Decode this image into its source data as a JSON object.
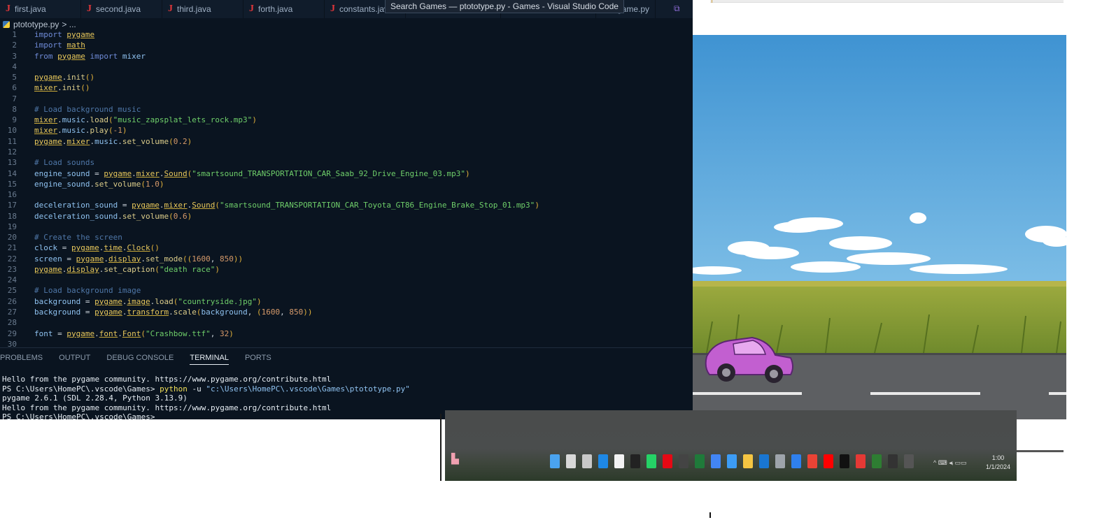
{
  "vscode": {
    "tabs": [
      {
        "label": "first.java",
        "type": "java"
      },
      {
        "label": "second.java",
        "type": "java"
      },
      {
        "label": "third.java",
        "type": "java"
      },
      {
        "label": "forth.java",
        "type": "java"
      },
      {
        "label": "constants.java",
        "type": "java"
      },
      {
        "label": "game.py",
        "type": "py"
      }
    ],
    "title_tooltip": "Search Games — ptototype.py - Games - Visual Studio Code",
    "breadcrumb": {
      "file": "ptototype.py",
      "sep": "> ..."
    },
    "code_lines": [
      {
        "n": "1",
        "tokens": [
          [
            "kw",
            "import "
          ],
          [
            "mod",
            "pygame"
          ]
        ]
      },
      {
        "n": "2",
        "tokens": [
          [
            "kw",
            "import "
          ],
          [
            "mod",
            "math"
          ]
        ]
      },
      {
        "n": "3",
        "tokens": [
          [
            "kw",
            "from "
          ],
          [
            "mod",
            "pygame"
          ],
          [
            "kw",
            " import "
          ],
          [
            "var",
            "mixer"
          ]
        ]
      },
      {
        "n": "4",
        "tokens": []
      },
      {
        "n": "5",
        "tokens": [
          [
            "mod",
            "pygame"
          ],
          [
            "op",
            "."
          ],
          [
            "fn",
            "init"
          ],
          [
            "par",
            "()"
          ]
        ]
      },
      {
        "n": "6",
        "tokens": [
          [
            "mod",
            "mixer"
          ],
          [
            "op",
            "."
          ],
          [
            "fn",
            "init"
          ],
          [
            "par",
            "()"
          ]
        ]
      },
      {
        "n": "7",
        "tokens": []
      },
      {
        "n": "8",
        "tokens": [
          [
            "cm",
            "# Load background music"
          ]
        ]
      },
      {
        "n": "9",
        "tokens": [
          [
            "mod",
            "mixer"
          ],
          [
            "op",
            "."
          ],
          [
            "var",
            "music"
          ],
          [
            "op",
            "."
          ],
          [
            "fn",
            "load"
          ],
          [
            "par",
            "("
          ],
          [
            "str",
            "\"music_zapsplat_lets_rock.mp3\""
          ],
          [
            "par",
            ")"
          ]
        ]
      },
      {
        "n": "10",
        "tokens": [
          [
            "mod",
            "mixer"
          ],
          [
            "op",
            "."
          ],
          [
            "var",
            "music"
          ],
          [
            "op",
            "."
          ],
          [
            "fn",
            "play"
          ],
          [
            "par",
            "("
          ],
          [
            "num",
            "-1"
          ],
          [
            "par",
            ")"
          ]
        ]
      },
      {
        "n": "11",
        "tokens": [
          [
            "mod",
            "pygame"
          ],
          [
            "op",
            "."
          ],
          [
            "mod",
            "mixer"
          ],
          [
            "op",
            "."
          ],
          [
            "var",
            "music"
          ],
          [
            "op",
            "."
          ],
          [
            "fn",
            "set_volume"
          ],
          [
            "par",
            "("
          ],
          [
            "num",
            "0.2"
          ],
          [
            "par",
            ")"
          ]
        ]
      },
      {
        "n": "12",
        "tokens": []
      },
      {
        "n": "13",
        "tokens": [
          [
            "cm",
            "# Load sounds"
          ]
        ]
      },
      {
        "n": "14",
        "tokens": [
          [
            "var",
            "engine_sound"
          ],
          [
            "op",
            " = "
          ],
          [
            "mod",
            "pygame"
          ],
          [
            "op",
            "."
          ],
          [
            "mod",
            "mixer"
          ],
          [
            "op",
            "."
          ],
          [
            "mod",
            "Sound"
          ],
          [
            "par",
            "("
          ],
          [
            "str",
            "\"smartsound_TRANSPORTATION_CAR_Saab_92_Drive_Engine_03.mp3\""
          ],
          [
            "par",
            ")"
          ]
        ]
      },
      {
        "n": "15",
        "tokens": [
          [
            "var",
            "engine_sound"
          ],
          [
            "op",
            "."
          ],
          [
            "fn",
            "set_volume"
          ],
          [
            "par",
            "("
          ],
          [
            "num",
            "1.0"
          ],
          [
            "par",
            ")"
          ]
        ]
      },
      {
        "n": "16",
        "tokens": []
      },
      {
        "n": "17",
        "tokens": [
          [
            "var",
            "deceleration_sound"
          ],
          [
            "op",
            " = "
          ],
          [
            "mod",
            "pygame"
          ],
          [
            "op",
            "."
          ],
          [
            "mod",
            "mixer"
          ],
          [
            "op",
            "."
          ],
          [
            "mod",
            "Sound"
          ],
          [
            "par",
            "("
          ],
          [
            "str",
            "\"smartsound_TRANSPORTATION_CAR_Toyota_GT86_Engine_Brake_Stop_01.mp3\""
          ],
          [
            "par",
            ")"
          ]
        ]
      },
      {
        "n": "18",
        "tokens": [
          [
            "var",
            "deceleration_sound"
          ],
          [
            "op",
            "."
          ],
          [
            "fn",
            "set_volume"
          ],
          [
            "par",
            "("
          ],
          [
            "num",
            "0.6"
          ],
          [
            "par",
            ")"
          ]
        ]
      },
      {
        "n": "19",
        "tokens": []
      },
      {
        "n": "20",
        "tokens": [
          [
            "cm",
            "# Create the screen"
          ]
        ]
      },
      {
        "n": "21",
        "tokens": [
          [
            "var",
            "clock"
          ],
          [
            "op",
            " = "
          ],
          [
            "mod",
            "pygame"
          ],
          [
            "op",
            "."
          ],
          [
            "mod",
            "time"
          ],
          [
            "op",
            "."
          ],
          [
            "mod",
            "Clock"
          ],
          [
            "par",
            "()"
          ]
        ]
      },
      {
        "n": "22",
        "tokens": [
          [
            "var",
            "screen"
          ],
          [
            "op",
            " = "
          ],
          [
            "mod",
            "pygame"
          ],
          [
            "op",
            "."
          ],
          [
            "mod",
            "display"
          ],
          [
            "op",
            "."
          ],
          [
            "fn",
            "set_mode"
          ],
          [
            "par",
            "(("
          ],
          [
            "num",
            "1600"
          ],
          [
            "op",
            ", "
          ],
          [
            "num",
            "850"
          ],
          [
            "par",
            "))"
          ]
        ]
      },
      {
        "n": "23",
        "tokens": [
          [
            "mod",
            "pygame"
          ],
          [
            "op",
            "."
          ],
          [
            "mod",
            "display"
          ],
          [
            "op",
            "."
          ],
          [
            "fn",
            "set_caption"
          ],
          [
            "par",
            "("
          ],
          [
            "str",
            "\"death race\""
          ],
          [
            "par",
            ")"
          ]
        ]
      },
      {
        "n": "24",
        "tokens": []
      },
      {
        "n": "25",
        "tokens": [
          [
            "cm",
            "# Load background image"
          ]
        ]
      },
      {
        "n": "26",
        "tokens": [
          [
            "var",
            "background"
          ],
          [
            "op",
            " = "
          ],
          [
            "mod",
            "pygame"
          ],
          [
            "op",
            "."
          ],
          [
            "mod",
            "image"
          ],
          [
            "op",
            "."
          ],
          [
            "fn",
            "load"
          ],
          [
            "par",
            "("
          ],
          [
            "str",
            "\"countryside.jpg\""
          ],
          [
            "par",
            ")"
          ]
        ]
      },
      {
        "n": "27",
        "tokens": [
          [
            "var",
            "background"
          ],
          [
            "op",
            " = "
          ],
          [
            "mod",
            "pygame"
          ],
          [
            "op",
            "."
          ],
          [
            "mod",
            "transform"
          ],
          [
            "op",
            "."
          ],
          [
            "fn",
            "scale"
          ],
          [
            "par",
            "("
          ],
          [
            "var",
            "background"
          ],
          [
            "op",
            ", "
          ],
          [
            "par",
            "("
          ],
          [
            "num",
            "1600"
          ],
          [
            "op",
            ", "
          ],
          [
            "num",
            "850"
          ],
          [
            "par",
            "))"
          ]
        ]
      },
      {
        "n": "28",
        "tokens": []
      },
      {
        "n": "29",
        "tokens": [
          [
            "var",
            "font"
          ],
          [
            "op",
            " = "
          ],
          [
            "mod",
            "pygame"
          ],
          [
            "op",
            "."
          ],
          [
            "mod",
            "font"
          ],
          [
            "op",
            "."
          ],
          [
            "mod",
            "Font"
          ],
          [
            "par",
            "("
          ],
          [
            "str",
            "\"Crashbow.ttf\""
          ],
          [
            "op",
            ", "
          ],
          [
            "num",
            "32"
          ],
          [
            "par",
            ")"
          ]
        ]
      },
      {
        "n": "30",
        "tokens": []
      }
    ],
    "panel_tabs": [
      "PROBLEMS",
      "OUTPUT",
      "DEBUG CONSOLE",
      "TERMINAL",
      "PORTS"
    ],
    "active_panel_tab": "TERMINAL",
    "terminal": {
      "line1": "Hello from the pygame community. https://www.pygame.org/contribute.html",
      "prompt": "PS C:\\Users\\HomePC\\.vscode\\Games> ",
      "cmd": "python",
      "flag": " -u ",
      "arg": "\"c:\\Users\\HomePC\\.vscode\\Games\\ptototype.py\"",
      "line3": "pygame 2.6.1 (SDL 2.28.4, Python 3.13.9)",
      "line4": "Hello from the pygame community. https://www.pygame.org/contribute.html",
      "line5": "PS C:\\Users\\HomePC\\.vscode\\Games>"
    }
  },
  "game": {
    "sky_color": "#4a9ad4",
    "grass_color": "#8ea23a",
    "road_color": "#5d5f62",
    "car_color": "#c25fd0"
  },
  "taskbar": {
    "icons": [
      "files-icon",
      "search-icon",
      "task-view-icon",
      "edge-icon",
      "store-icon",
      "tiktok-icon",
      "whatsapp-icon",
      "netflix-icon",
      "app-icon",
      "excel-icon",
      "photos-icon",
      "bluesky-icon",
      "folder-icon",
      "paint-icon",
      "settings-icon",
      "vscode-icon",
      "chrome-icon",
      "youtube-icon",
      "roblox-icon",
      "app2-icon",
      "xbox-icon",
      "github-icon",
      "active-app-icon"
    ],
    "tray_text": "^ ⌨ ◂ᵢ ▭▭",
    "clock_time": "1:00",
    "clock_date": "1/1/2024"
  }
}
